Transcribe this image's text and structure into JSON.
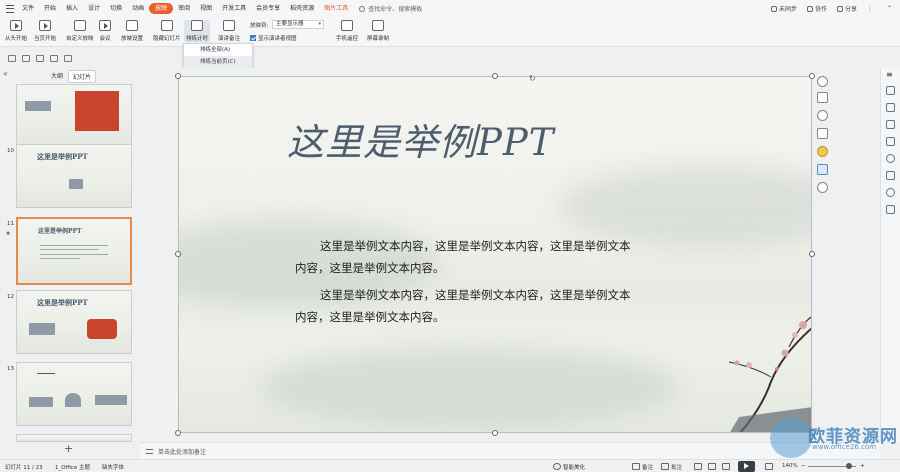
{
  "menubar": {
    "items": [
      "文件",
      "开始",
      "插入",
      "设计",
      "切换",
      "动画",
      "放映",
      "审阅",
      "视图",
      "开发工具",
      "会员专享",
      "稻壳资源",
      "图片工具"
    ],
    "active": "放映",
    "search_placeholder": "查找命令、搜索模板",
    "right": {
      "sync": "未同步",
      "collab": "协作",
      "share": "分享"
    }
  },
  "ribbon": {
    "buttons": [
      "从头开始",
      "当页开始",
      "自定义放映",
      "会议",
      "放映设置",
      "隐藏幻灯片",
      "排练计时",
      "演讲备注",
      "手机遥控",
      "屏幕录制"
    ],
    "monitor_label": "放映到:",
    "monitor_value": "主要显示器",
    "show_presenter_view": "显示演讲者视图"
  },
  "dropdown": {
    "items": [
      "排练全部(A)",
      "排练当前页(C)"
    ]
  },
  "left_panel": {
    "tabs": [
      "大纲",
      "幻灯片"
    ],
    "active_tab": "幻灯片",
    "thumbnails": [
      {
        "num": "",
        "title": ""
      },
      {
        "num": "10",
        "title": "这里是举例PPT"
      },
      {
        "num": "11",
        "title": "这里是举例PPT"
      },
      {
        "num": "12",
        "title": "这里是举例PPT"
      },
      {
        "num": "13",
        "title": ""
      }
    ],
    "add_label": "+"
  },
  "slide": {
    "title": "这里是举例PPT",
    "paragraphs": [
      "这里是举例文本内容，这里是举例文本内容，这里是举例文本内容，这里是举例文本内容。",
      "这里是举例文本内容，这里是举例文本内容，这里是举例文本内容，这里是举例文本内容。"
    ]
  },
  "notes": {
    "placeholder": "单击此处添加备注"
  },
  "status": {
    "slide_count": "幻灯片 11 / 23",
    "theme": "1_Office 主题",
    "missing_font": "缺失字体",
    "smart_beautify": "智能美化",
    "notes": "备注",
    "comments": "批注",
    "zoom": "140%"
  },
  "watermark": {
    "brand": "欧菲资源网",
    "url": "www.office26.com"
  },
  "colors": {
    "accent": "#e8612c",
    "title": "#4d5d6d"
  }
}
